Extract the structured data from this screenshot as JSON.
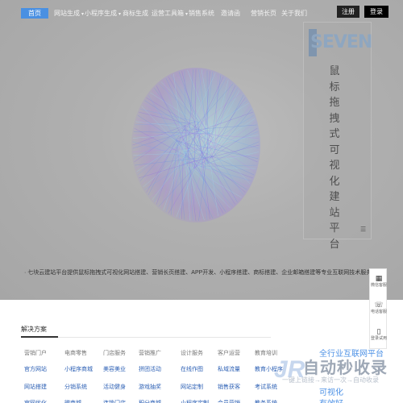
{
  "nav": {
    "home": "首页",
    "site_gen": "网站生成",
    "mini_gen": "小程序生成",
    "trademark": "商标生成",
    "ops_tools": "运营工具箱",
    "sales": "销售系统",
    "invite": "邀请函",
    "long_page": "营销长页",
    "about": "关于我们",
    "register": "注册",
    "login": "登录"
  },
  "hero": {
    "logo_text": "SEVEN",
    "vertical_title": "鼠标拖拽式可视化建站平台",
    "menu_icon": "hamburger-icon",
    "intro": "· 七块云建站平台提供鼠标拖拽式可视化网站搭建、营销长页搭建、APP开发、小程序搭建、商标搭建、企业邮箱搭建等专业互联网技术服务，注册登录免费试用"
  },
  "solutions": {
    "tab_label": "解决方案",
    "columns": [
      {
        "head": "营销门户",
        "items": [
          "官方网站",
          "网站搭建",
          "官网优化"
        ]
      },
      {
        "head": "电商零售",
        "items": [
          "小程序商城",
          "分销系统",
          "微商城"
        ]
      },
      {
        "head": "门店服务",
        "items": [
          "美容美业",
          "活动健身",
          "连锁门店"
        ]
      },
      {
        "head": "营销推广",
        "items": [
          "拼团活动",
          "游戏抽奖",
          "积分商城"
        ]
      },
      {
        "head": "设计服务",
        "items": [
          "在线作图",
          "网站定制",
          "小程序定制"
        ]
      },
      {
        "head": "客户运营",
        "items": [
          "私域流量",
          "销售获客",
          "会员营销"
        ]
      },
      {
        "head": "教育培训",
        "items": [
          "教育小程序",
          "考试系统",
          "教务系统"
        ]
      }
    ]
  },
  "sidebar": {
    "wechat": {
      "icon": "qrcode-icon",
      "label": "微信客服"
    },
    "phone": {
      "icon": "phone-icon",
      "label": "电话客服"
    },
    "trial": {
      "icon": "mobile-icon",
      "label": "登录试用"
    }
  },
  "watermark": {
    "logo": "JR",
    "title": "自动秒收录",
    "subtitle": "一键上链接→来访一次→自动收录",
    "blue_line1": "全行业互联网平台",
    "blue_line2": "可视化",
    "blue_line3": "有效好"
  },
  "colors": {
    "accent": "#4a90e2",
    "link": "#2b5fb4",
    "register_bg": "#222222",
    "login_bg": "#000000"
  }
}
